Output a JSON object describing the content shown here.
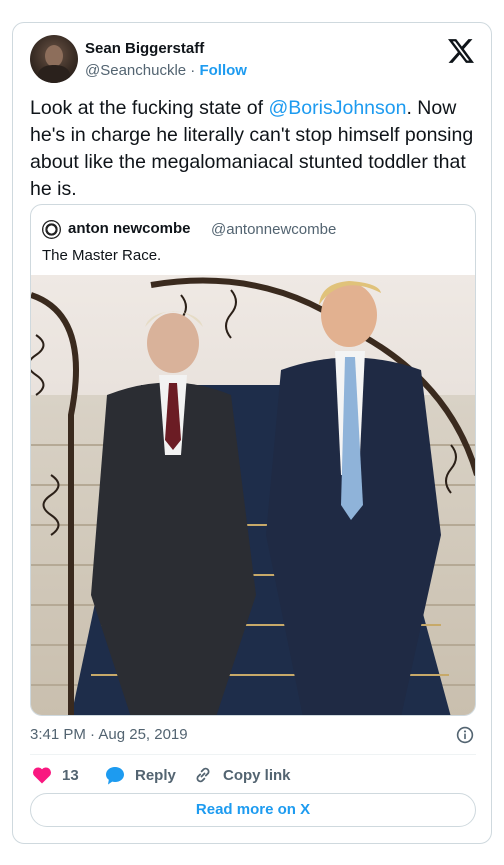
{
  "author": {
    "name": "Sean Biggerstaff",
    "handle": "@Seanchuckle",
    "separator": "·",
    "follow_label": "Follow"
  },
  "tweet": {
    "text_before": "Look at the fucking state of ",
    "mention": "@BorisJohnson",
    "text_after": ". Now he's in charge he literally can't stop himself ponsing about like the megalomaniacal stunted toddler that he is."
  },
  "quoted": {
    "name": "anton newcombe",
    "handle": "@antonnewcombe",
    "text": "The Master Race."
  },
  "timestamp": "3:41 PM · Aug 25, 2019",
  "actions": {
    "like_count": "13",
    "reply_label": "Reply",
    "copy_label": "Copy link"
  },
  "read_more_label": "Read more on X",
  "colors": {
    "accent": "#1d9bf0",
    "like": "#f91880",
    "secondary_text": "#536471",
    "border": "#cfd9de"
  },
  "icons": [
    "x-logo-icon",
    "info-icon",
    "heart-icon",
    "reply-bubble-icon",
    "link-icon"
  ]
}
